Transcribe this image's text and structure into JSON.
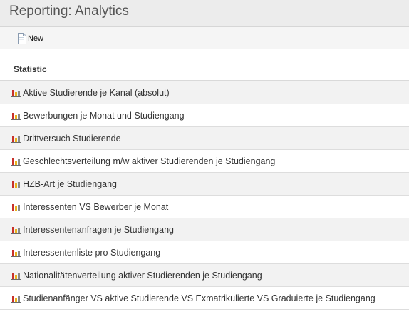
{
  "page": {
    "title": "Reporting: Analytics"
  },
  "toolbar": {
    "new_label": "New",
    "new_icon": "new-document-icon"
  },
  "table": {
    "column_header": "Statistic",
    "row_icon": "bar-chart-icon",
    "rows": [
      {
        "label": "Aktive Studierende je Kanal (absolut)"
      },
      {
        "label": "Bewerbungen je Monat und Studiengang"
      },
      {
        "label": "Drittversuch Studierende"
      },
      {
        "label": "Geschlechtsverteilung m/w aktiver Studierenden je Studiengang"
      },
      {
        "label": "HZB-Art je Studiengang"
      },
      {
        "label": "Interessenten VS Bewerber je Monat"
      },
      {
        "label": "Interessentenanfragen je Studiengang"
      },
      {
        "label": "Interessentenliste pro Studiengang"
      },
      {
        "label": "Nationalitätenverteilung aktiver Studierenden je Studiengang"
      },
      {
        "label": "Studienanfänger VS aktive Studierende VS Exmatrikulierte VS Graduierte je Studiengang"
      }
    ]
  },
  "colors": {
    "title_bar_bg": "#ececec",
    "toolbar_bg": "#f5f5f5",
    "row_alt_bg": "#f2f2f2",
    "chart_icon_red": "#c8322a",
    "chart_icon_yellow": "#e8b21c",
    "chart_icon_gray": "#6a6a6a"
  }
}
